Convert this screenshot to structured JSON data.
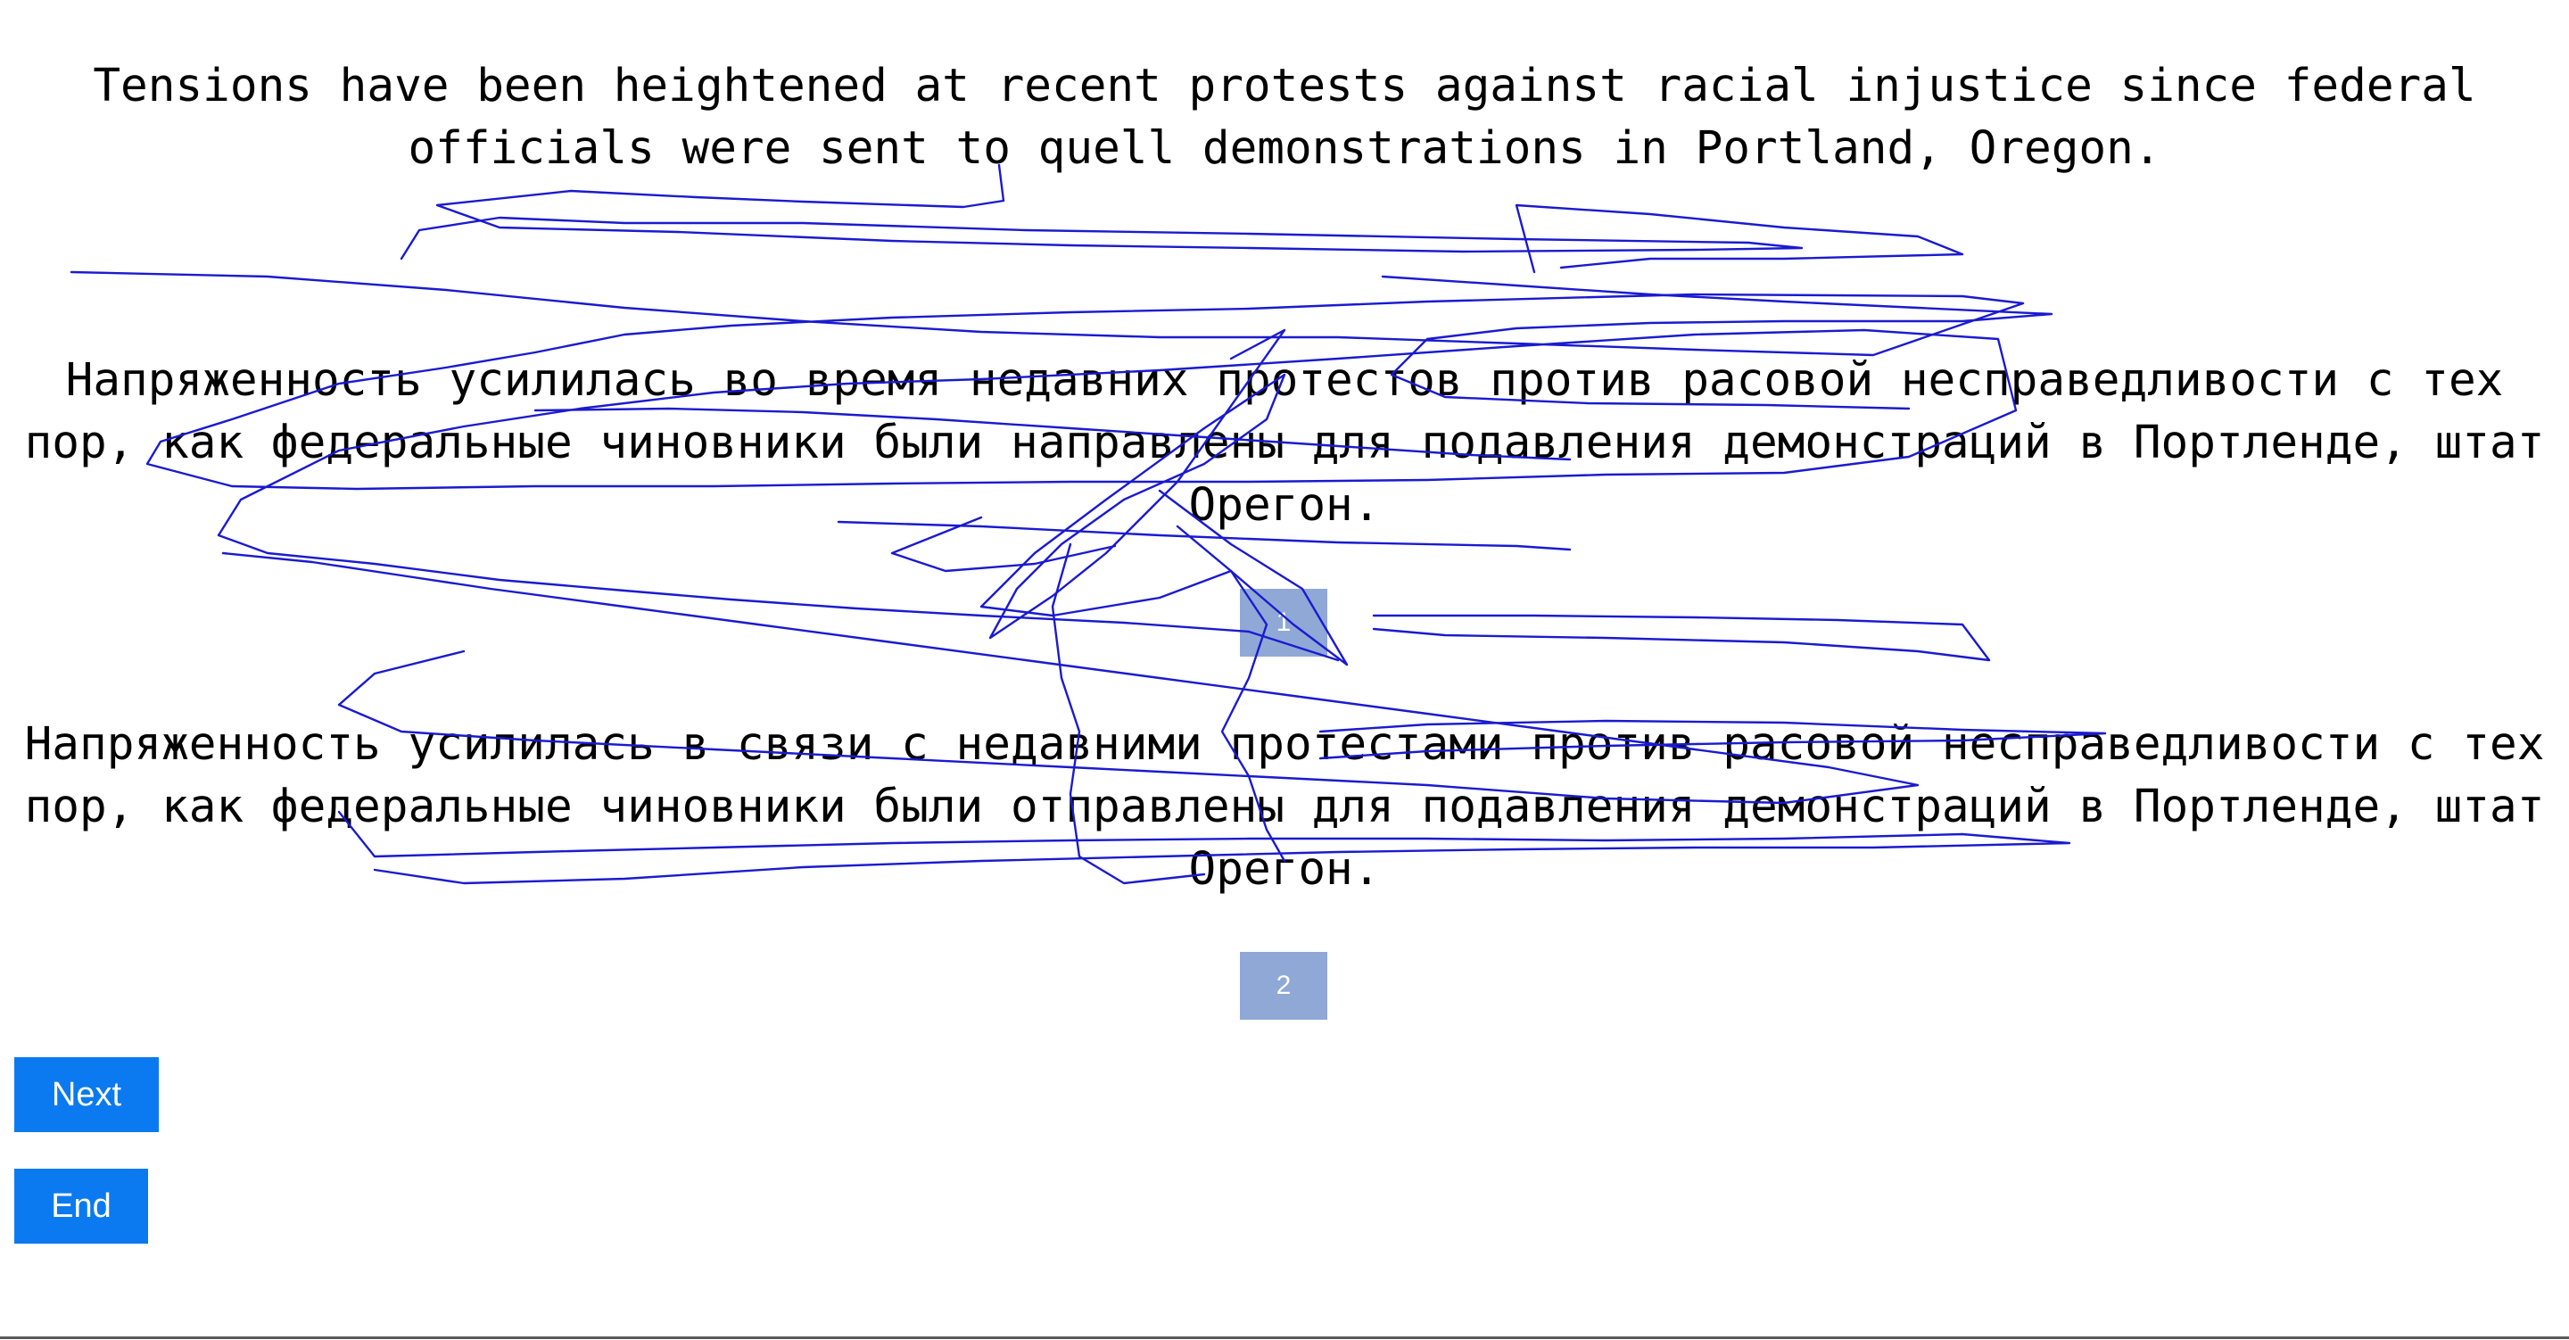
{
  "source": {
    "text": "Tensions have been heightened at recent protests against racial injustice since federal officials were sent to quell demonstrations in Portland, Oregon."
  },
  "translations": [
    {
      "text": "Напряженность усилилась во время недавних протестов против расовой несправедливости с тех пор, как федеральные чиновники были направлены для подавления демонстраций в Портленде, штат Орегон.",
      "choice_label": "1"
    },
    {
      "text": "Напряженность усилилась в связи с недавними протестами против расовой несправедливости с тех пор, как федеральные чиновники были отправлены для подавления демонстраций в Портленде, штат Орегон.",
      "choice_label": "2"
    }
  ],
  "buttons": {
    "next_label": "Next",
    "end_label": "End"
  },
  "colors": {
    "choice_box": "#8fa8d6",
    "button": "#0b7af0",
    "scribble": "#1a1ad0"
  }
}
